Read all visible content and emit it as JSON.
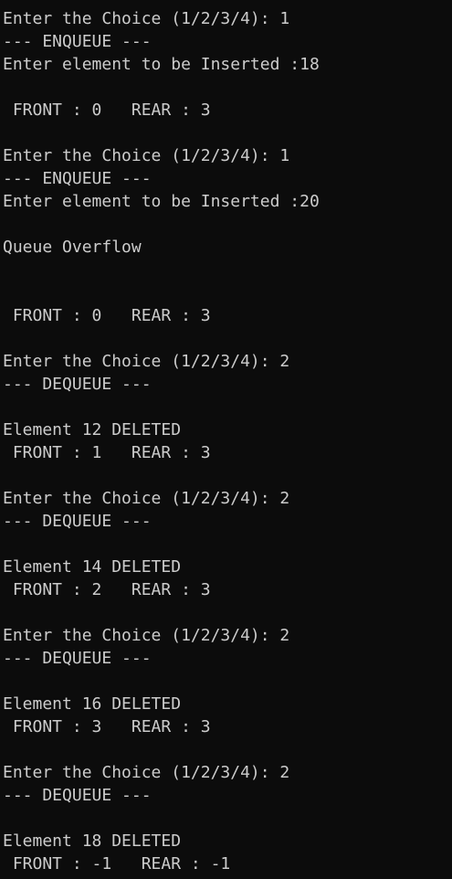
{
  "console": {
    "lines": [
      "Enter the Choice (1/2/3/4): 1",
      "--- ENQUEUE ---",
      "Enter element to be Inserted :18",
      "",
      " FRONT : 0   REAR : 3",
      "",
      "Enter the Choice (1/2/3/4): 1",
      "--- ENQUEUE ---",
      "Enter element to be Inserted :20",
      "",
      "Queue Overflow",
      "",
      "",
      " FRONT : 0   REAR : 3",
      "",
      "Enter the Choice (1/2/3/4): 2",
      "--- DEQUEUE ---",
      "",
      "Element 12 DELETED",
      " FRONT : 1   REAR : 3",
      "",
      "Enter the Choice (1/2/3/4): 2",
      "--- DEQUEUE ---",
      "",
      "Element 14 DELETED",
      " FRONT : 2   REAR : 3",
      "",
      "Enter the Choice (1/2/3/4): 2",
      "--- DEQUEUE ---",
      "",
      "Element 16 DELETED",
      " FRONT : 3   REAR : 3",
      "",
      "Enter the Choice (1/2/3/4): 2",
      "--- DEQUEUE ---",
      "",
      "Element 18 DELETED",
      " FRONT : -1   REAR : -1"
    ]
  }
}
